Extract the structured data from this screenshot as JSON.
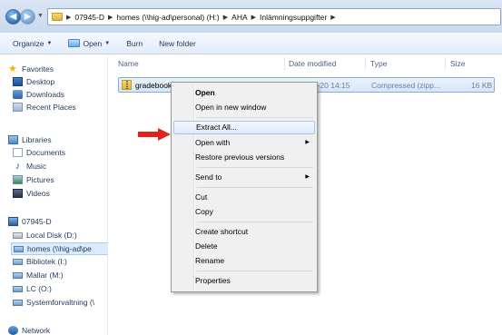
{
  "address": {
    "crumbs": [
      "07945-D",
      "homes (\\\\hig-ad\\personal) (H:)",
      "AHA",
      "Inlämningsuppgifter"
    ]
  },
  "toolbar": {
    "organize": "Organize",
    "open": "Open",
    "burn": "Burn",
    "new_folder": "New folder"
  },
  "navpane": {
    "favorites": "Favorites",
    "desktop": "Desktop",
    "downloads": "Downloads",
    "recent": "Recent Places",
    "libraries": "Libraries",
    "documents": "Documents",
    "music": "Music",
    "pictures": "Pictures",
    "videos": "Videos",
    "computer": "07945-D",
    "local_disk": "Local Disk (D:)",
    "homes": "homes (\\\\hig-ad\\pe",
    "bibliotek": "Bibliotek (I:)",
    "mallar": "Mallar (M:)",
    "lc": "LC (O:)",
    "systemforvaltning": "Systemforvaltning (\\",
    "network": "Network"
  },
  "columns": {
    "name": "Name",
    "date": "Date modified",
    "type": "Type",
    "size": "Size"
  },
  "file": {
    "name": "gradebook_HT11_14323_Studieuppgift20",
    "date": "2011-10-20 14:15",
    "type": "Compressed (zipp...",
    "size": "16 KB"
  },
  "context_menu": {
    "open": "Open",
    "open_new_window": "Open in new window",
    "extract_all": "Extract All...",
    "open_with": "Open with",
    "restore": "Restore previous versions",
    "send_to": "Send to",
    "cut": "Cut",
    "copy": "Copy",
    "create_shortcut": "Create shortcut",
    "delete": "Delete",
    "rename": "Rename",
    "properties": "Properties"
  },
  "colors": {
    "arrow": "#e0241c",
    "selection": "#d4e6fa"
  }
}
